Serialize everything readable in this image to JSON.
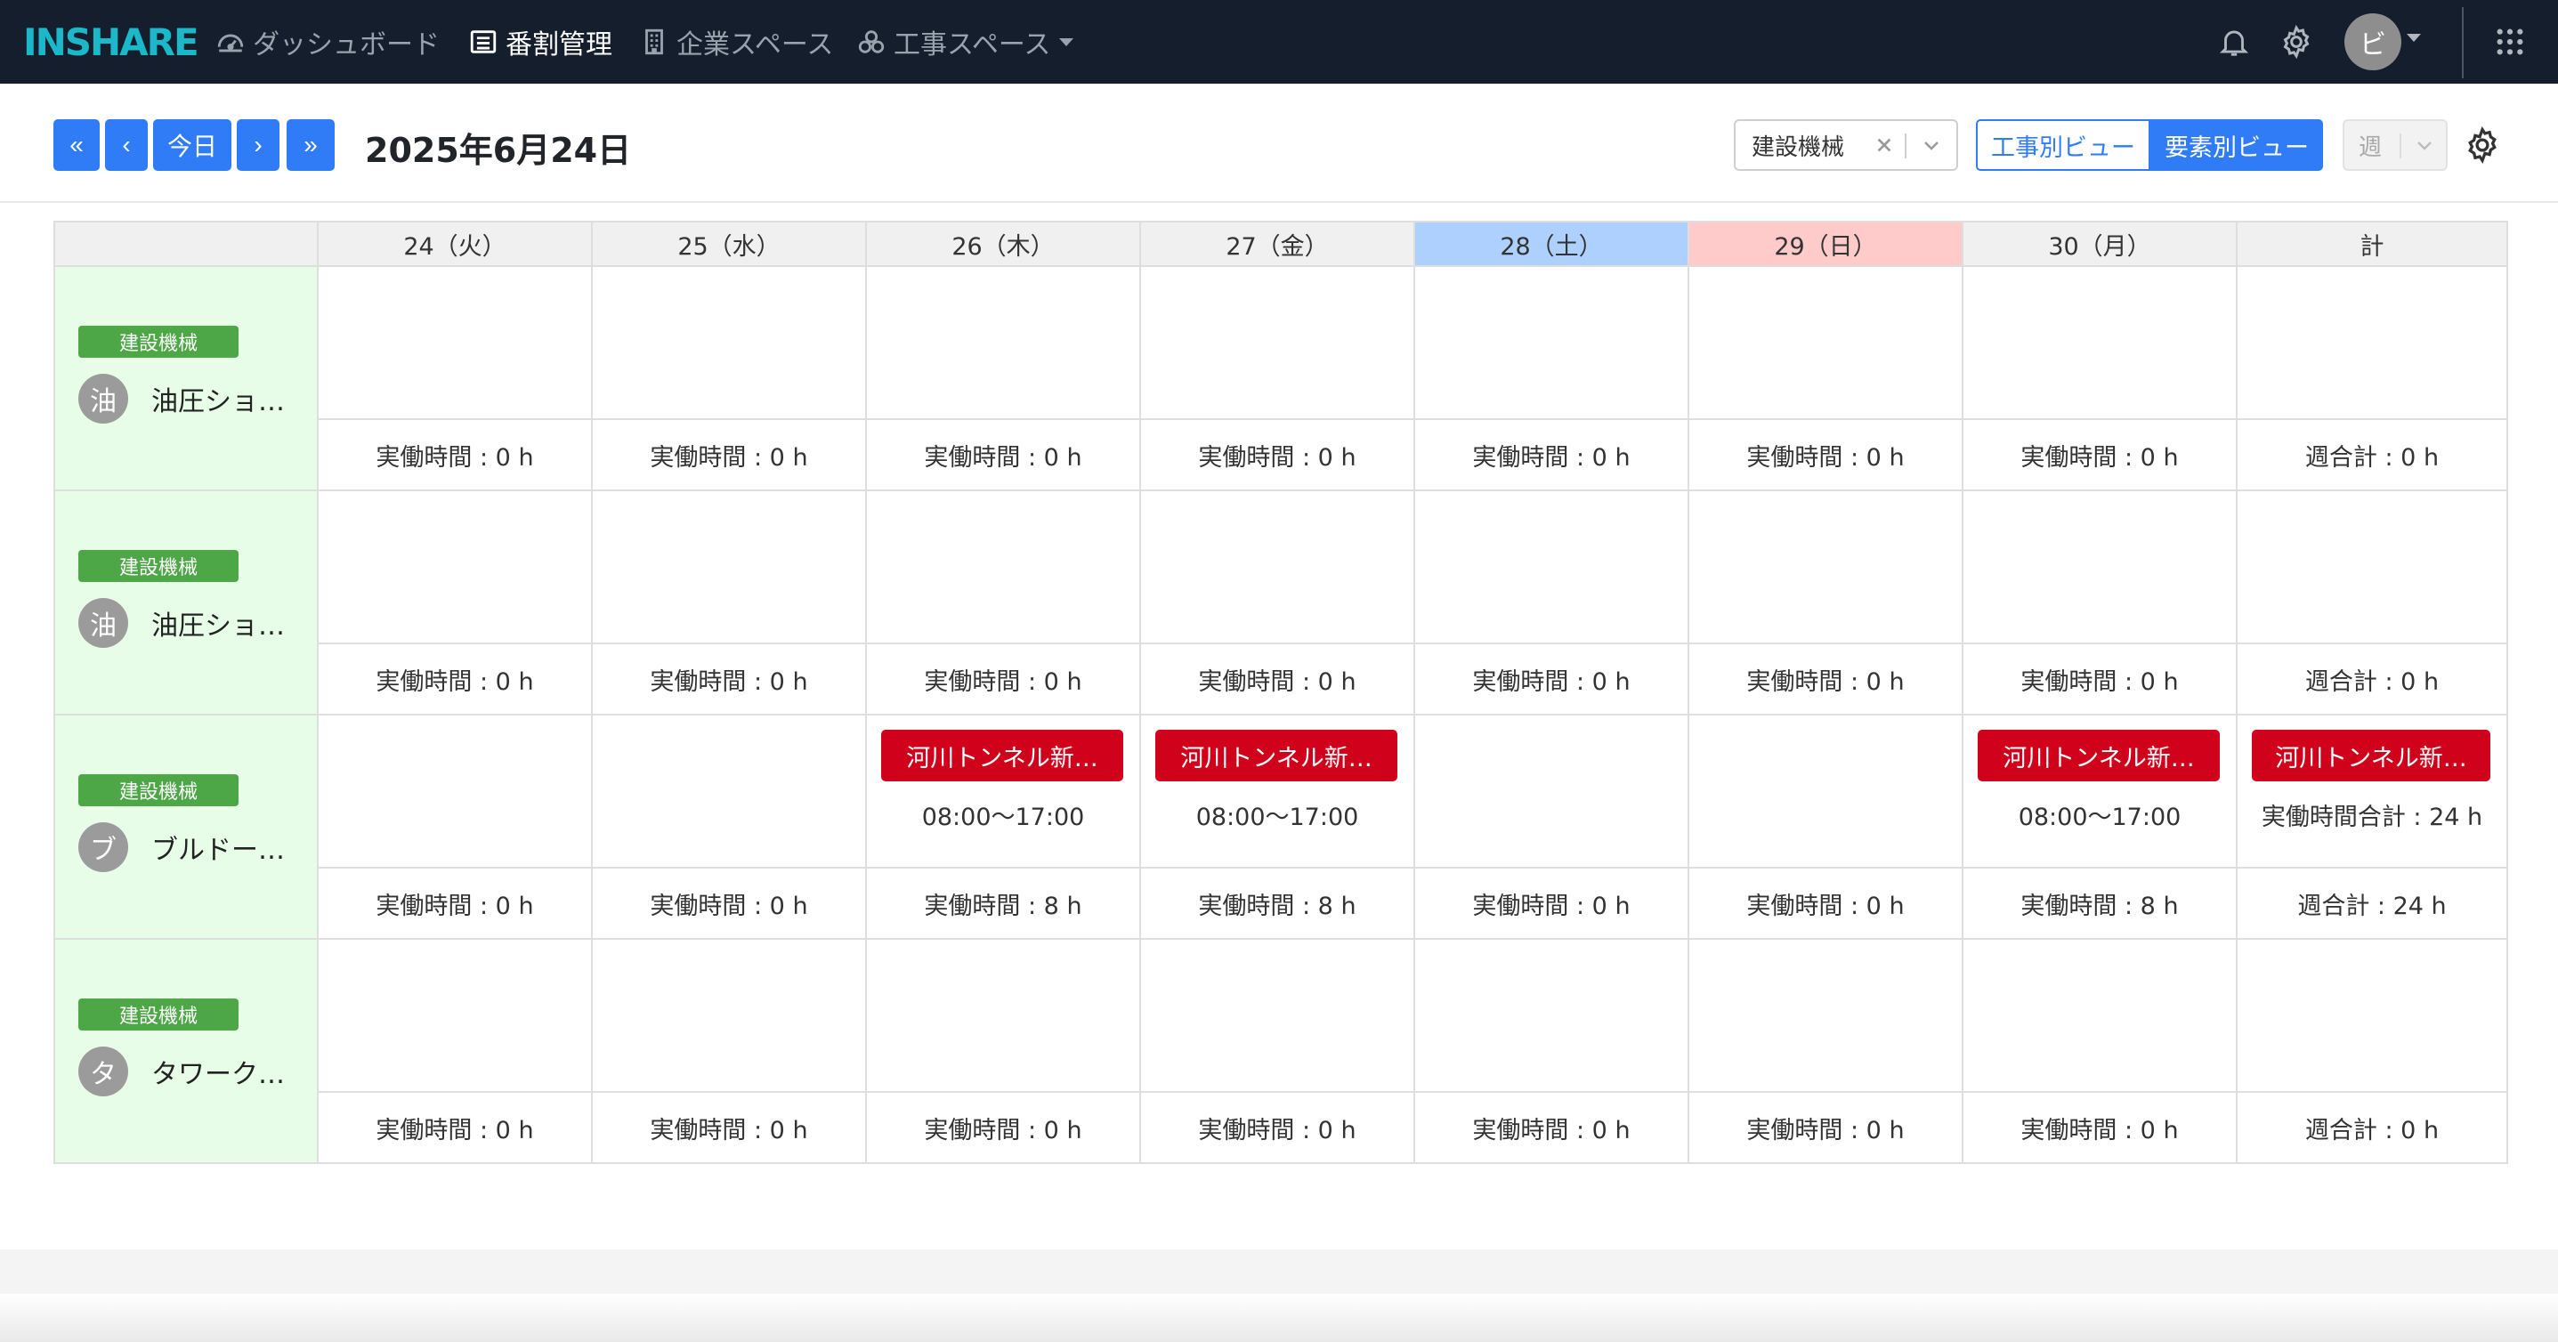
{
  "app": {
    "logo": "INSHARE",
    "nav": [
      {
        "label": "ダッシュボード",
        "icon": "dashboard-icon"
      },
      {
        "label": "番割管理",
        "icon": "list-icon",
        "active": true
      },
      {
        "label": "企業スペース",
        "icon": "building-icon"
      },
      {
        "label": "工事スペース",
        "icon": "construction-icon",
        "dropdown": true
      }
    ],
    "user_initial": "ビ"
  },
  "toolbar": {
    "first_label": "«",
    "prev_label": "‹",
    "today_label": "今日",
    "next_label": "›",
    "last_label": "»",
    "date_title": "2025年6月24日",
    "filter_value": "建設機械",
    "view_project_label": "工事別ビュー",
    "view_element_label": "要素別ビュー",
    "period_value": "週"
  },
  "colors": {
    "accent": "#2f7cf6",
    "navbar": "#141e2d",
    "event": "#d0021b",
    "badge": "#4ea747",
    "saturday": "#aed0ff",
    "sunday": "#ffcaca",
    "label_bg": "#e7fde8"
  },
  "schedule": {
    "columns": [
      "24（火）",
      "25（水）",
      "26（木）",
      "27（金）",
      "28（土）",
      "29（日）",
      "30（月）",
      "計"
    ],
    "rows": [
      {
        "badge": "建設機械",
        "initial": "油",
        "name": "油圧ショ…",
        "cells": [
          {
            "event": "",
            "time": "",
            "foot": "実働時間 : 0 h"
          },
          {
            "event": "",
            "time": "",
            "foot": "実働時間 : 0 h"
          },
          {
            "event": "",
            "time": "",
            "foot": "実働時間 : 0 h"
          },
          {
            "event": "",
            "time": "",
            "foot": "実働時間 : 0 h"
          },
          {
            "event": "",
            "time": "",
            "foot": "実働時間 : 0 h"
          },
          {
            "event": "",
            "time": "",
            "foot": "実働時間 : 0 h"
          },
          {
            "event": "",
            "time": "",
            "foot": "実働時間 : 0 h"
          },
          {
            "event": "",
            "time": "",
            "foot": "週合計 : 0 h"
          }
        ]
      },
      {
        "badge": "建設機械",
        "initial": "油",
        "name": "油圧ショ…",
        "cells": [
          {
            "event": "",
            "time": "",
            "foot": "実働時間 : 0 h"
          },
          {
            "event": "",
            "time": "",
            "foot": "実働時間 : 0 h"
          },
          {
            "event": "",
            "time": "",
            "foot": "実働時間 : 0 h"
          },
          {
            "event": "",
            "time": "",
            "foot": "実働時間 : 0 h"
          },
          {
            "event": "",
            "time": "",
            "foot": "実働時間 : 0 h"
          },
          {
            "event": "",
            "time": "",
            "foot": "実働時間 : 0 h"
          },
          {
            "event": "",
            "time": "",
            "foot": "実働時間 : 0 h"
          },
          {
            "event": "",
            "time": "",
            "foot": "週合計 : 0 h"
          }
        ]
      },
      {
        "badge": "建設機械",
        "initial": "ブ",
        "name": "ブルドー…",
        "cells": [
          {
            "event": "",
            "time": "",
            "foot": "実働時間 : 0 h"
          },
          {
            "event": "",
            "time": "",
            "foot": "実働時間 : 0 h"
          },
          {
            "event": "河川トンネル新…",
            "time": "08:00〜17:00",
            "foot": "実働時間 : 8 h"
          },
          {
            "event": "河川トンネル新…",
            "time": "08:00〜17:00",
            "foot": "実働時間 : 8 h"
          },
          {
            "event": "",
            "time": "",
            "foot": "実働時間 : 0 h"
          },
          {
            "event": "",
            "time": "",
            "foot": "実働時間 : 0 h"
          },
          {
            "event": "河川トンネル新…",
            "time": "08:00〜17:00",
            "foot": "実働時間 : 8 h"
          },
          {
            "event": "河川トンネル新…",
            "time": "実働時間合計 : 24 h",
            "foot": "週合計 : 24 h"
          }
        ]
      },
      {
        "badge": "建設機械",
        "initial": "タ",
        "name": "タワーク…",
        "cells": [
          {
            "event": "",
            "time": "",
            "foot": "実働時間 : 0 h"
          },
          {
            "event": "",
            "time": "",
            "foot": "実働時間 : 0 h"
          },
          {
            "event": "",
            "time": "",
            "foot": "実働時間 : 0 h"
          },
          {
            "event": "",
            "time": "",
            "foot": "実働時間 : 0 h"
          },
          {
            "event": "",
            "time": "",
            "foot": "実働時間 : 0 h"
          },
          {
            "event": "",
            "time": "",
            "foot": "実働時間 : 0 h"
          },
          {
            "event": "",
            "time": "",
            "foot": "実働時間 : 0 h"
          },
          {
            "event": "",
            "time": "",
            "foot": "週合計 : 0 h"
          }
        ]
      }
    ]
  }
}
